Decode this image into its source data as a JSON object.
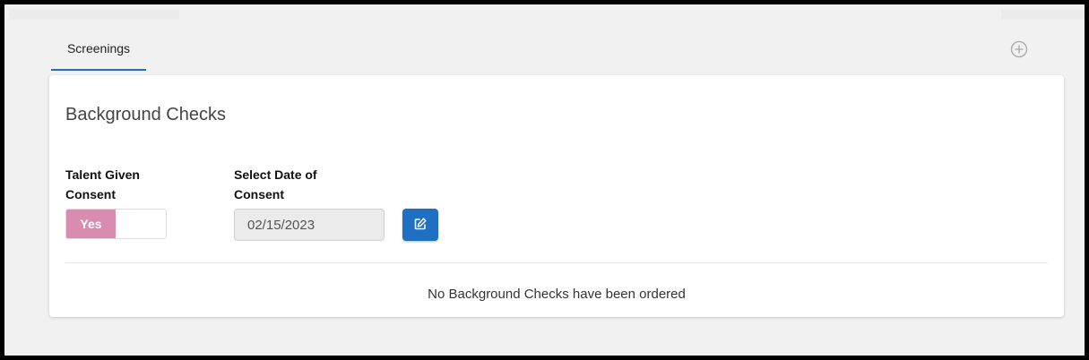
{
  "tabs": [
    {
      "label": "Screenings",
      "active": true
    }
  ],
  "card": {
    "title": "Background Checks",
    "consent_label": "Talent Given Consent",
    "consent_value": "Yes",
    "consent_color": "#d98bb0",
    "date_label": "Select Date of Consent",
    "date_value": "02/15/2023",
    "edit_button_icon": "edit-icon",
    "empty_message": "No Background Checks have been ordered"
  },
  "icons": {
    "add": "plus-circle-icon",
    "edit": "edit-icon"
  },
  "colors": {
    "accent": "#1f6fc2",
    "toggle_on": "#d98bb0"
  }
}
